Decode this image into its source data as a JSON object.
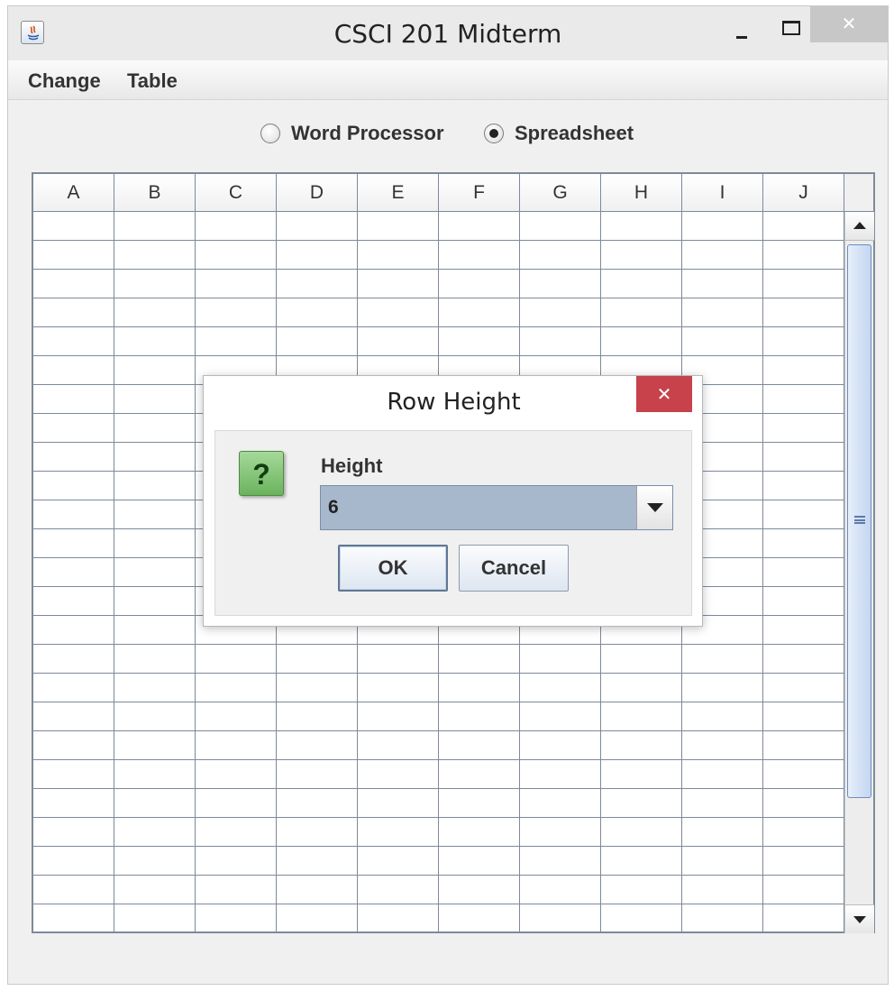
{
  "window": {
    "title": "CSCI 201 Midterm",
    "close_glyph": "✕"
  },
  "menu": {
    "items": [
      "Change",
      "Table"
    ]
  },
  "mode": {
    "options": [
      {
        "label": "Word Processor",
        "checked": false
      },
      {
        "label": "Spreadsheet",
        "checked": true
      }
    ]
  },
  "table": {
    "columns": [
      "A",
      "B",
      "C",
      "D",
      "E",
      "F",
      "G",
      "H",
      "I",
      "J"
    ],
    "visible_rows": 25
  },
  "dialog": {
    "title": "Row Height",
    "close_glyph": "✕",
    "icon_glyph": "?",
    "field_label": "Height",
    "selected_value": "6",
    "ok_label": "OK",
    "cancel_label": "Cancel"
  },
  "colors": {
    "dialog_close": "#c7424a",
    "question_icon": "#6bb35d",
    "combo_selected": "#a8b8cc",
    "scroll_thumb": "#c4d6f1",
    "grid_lines": "#7d8a99"
  }
}
